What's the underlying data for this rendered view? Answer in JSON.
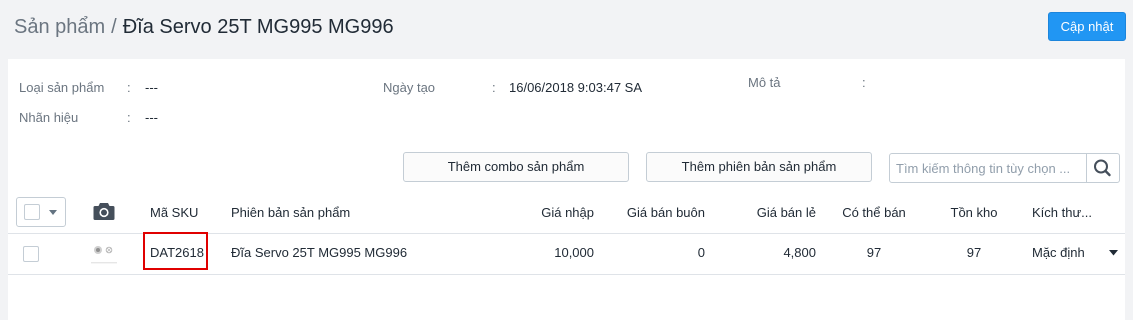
{
  "breadcrumb": {
    "parent": "Sản phẩm",
    "separator": "/",
    "current": "Đĩa Servo 25T MG995 MG996"
  },
  "header": {
    "update_button": "Cập nhật"
  },
  "info": {
    "product_type": {
      "label": "Loại sản phẩm",
      "colon": ":",
      "value": "---"
    },
    "brand": {
      "label": "Nhãn hiệu",
      "colon": ":",
      "value": "---"
    },
    "created": {
      "label": "Ngày tạo",
      "colon": ":",
      "value": "16/06/2018 9:03:47 SA"
    },
    "description": {
      "label": "Mô tả",
      "colon": ":",
      "value": ""
    }
  },
  "actions": {
    "add_combo": "Thêm combo sản phẩm",
    "add_variant": "Thêm phiên bản sản phẩm",
    "search_placeholder": "Tìm kiếm thông tin tùy chọn ..."
  },
  "table": {
    "columns": {
      "sku": "Mã SKU",
      "variant": "Phiên bản sản phẩm",
      "import_price": "Giá nhập",
      "wholesale_price": "Giá bán buôn",
      "retail_price": "Giá bán lẻ",
      "available": "Có thể bán",
      "stock": "Tồn kho",
      "size": "Kích thư..."
    },
    "rows": [
      {
        "sku": "DAT2618",
        "variant": "Đĩa Servo 25T MG995 MG996",
        "import_price": "10,000",
        "wholesale_price": "0",
        "retail_price": "4,800",
        "available": "97",
        "stock": "97",
        "size": "Mặc định"
      }
    ]
  },
  "icons": [
    "camera-icon",
    "search-icon",
    "chevron-down-icon",
    "caret-down-icon"
  ],
  "colors": {
    "primary": "#2196f3",
    "highlight": "#e00000"
  }
}
